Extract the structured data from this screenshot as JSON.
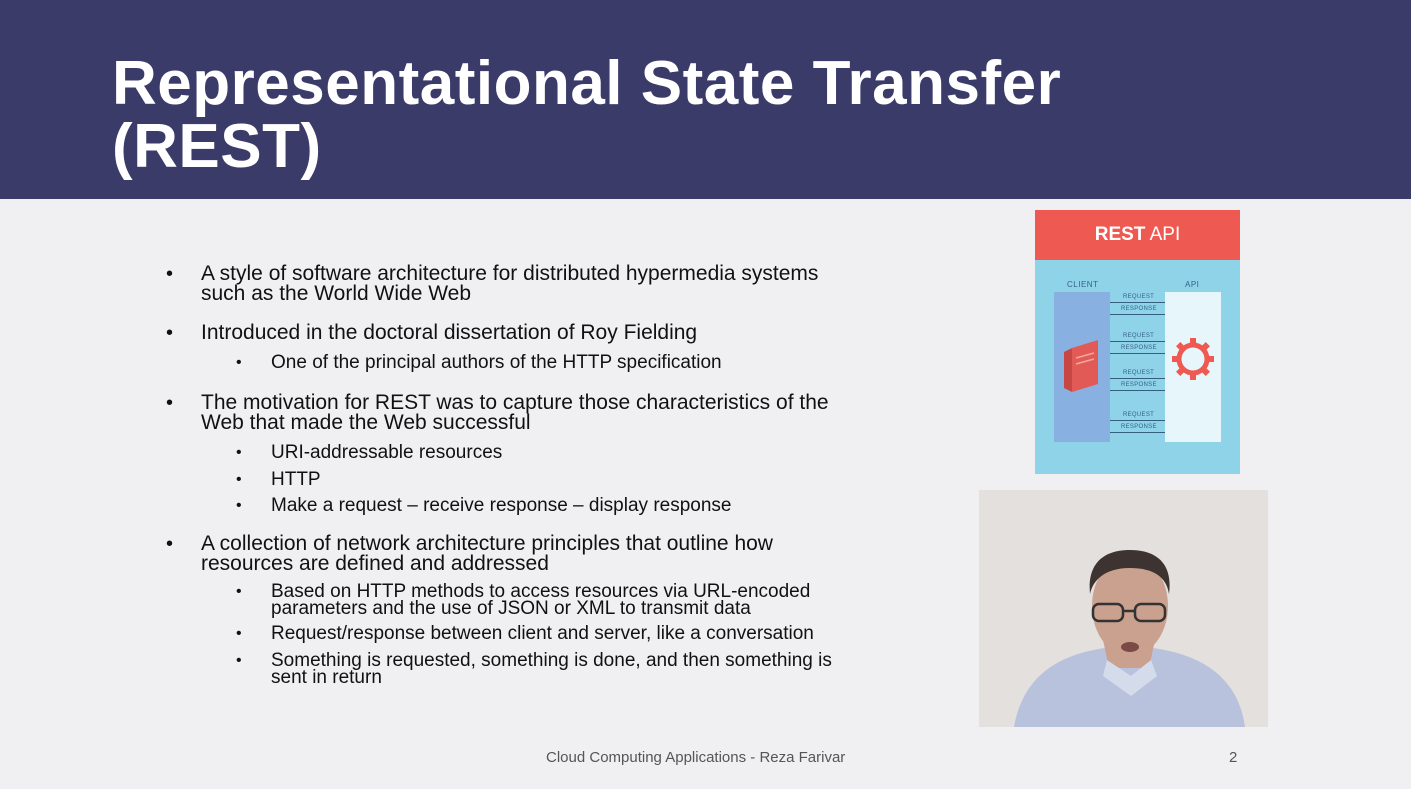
{
  "slide": {
    "title": "Representational State Transfer (REST)",
    "bullets": [
      {
        "text": "A style of software architecture for distributed hypermedia systems such as the World Wide Web",
        "level": 1
      },
      {
        "text": "Introduced in the doctoral dissertation of Roy Fielding",
        "level": 1
      },
      {
        "text": "One of the principal authors of the HTTP specification",
        "level": 2
      },
      {
        "text": "The motivation for REST was to capture those characteristics of the Web that made the Web successful",
        "level": 1
      },
      {
        "text": "URI-addressable resources",
        "level": 2
      },
      {
        "text": "HTTP",
        "level": 2
      },
      {
        "text": "Make a request – receive response – display response",
        "level": 2
      },
      {
        "text": "A collection of network architecture principles that outline how resources are defined and addressed",
        "level": 1
      },
      {
        "text": "Based on HTTP methods to access resources via URL-encoded parameters and the use of JSON or XML to transmit data",
        "level": 2
      },
      {
        "text": "Request/response between client and server, like a conversation",
        "level": 2
      },
      {
        "text": "Something is requested, something is done, and then something is sent in return",
        "level": 2
      }
    ],
    "footer": "Cloud Computing Applications - Reza Farivar",
    "page_number": "2"
  },
  "rest_api_figure": {
    "heading_bold": "REST",
    "heading_rest": " API",
    "client_label": "CLIENT",
    "api_label": "API",
    "request_label": "REQUEST",
    "response_label": "RESPONSE",
    "colors": {
      "card": "#8ed3e7",
      "header": "#ee5a52",
      "client": "#88b1e2",
      "api": "#e6f6fb",
      "icon": "#ee5a52"
    }
  },
  "icons": {
    "server": "server-icon",
    "gear": "gear-icon",
    "presenter": "presenter-video"
  }
}
